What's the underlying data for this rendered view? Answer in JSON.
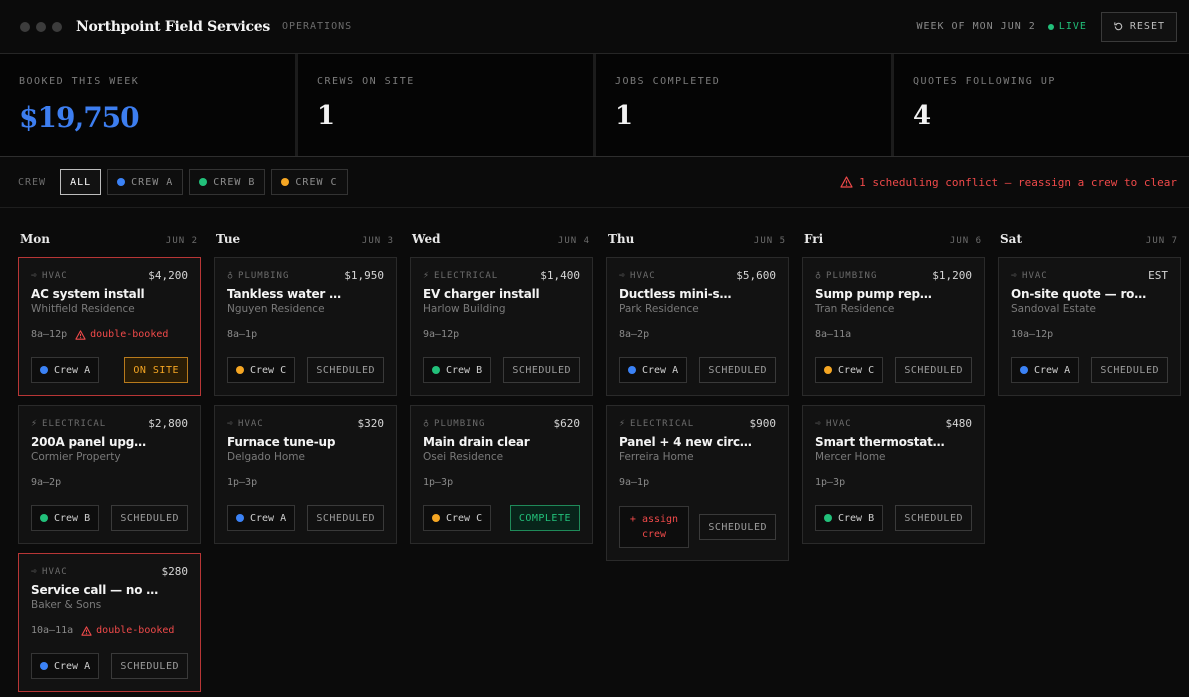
{
  "header": {
    "title": "Northpoint Field Services",
    "subtitle": "OPERATIONS",
    "week": "WEEK OF MON JUN 2",
    "live": "LIVE",
    "reset": "RESET"
  },
  "stats": [
    {
      "label": "BOOKED THIS WEEK",
      "value": "$19,750"
    },
    {
      "label": "CREWS ON SITE",
      "value": "1"
    },
    {
      "label": "JOBS COMPLETED",
      "value": "1"
    },
    {
      "label": "QUOTES FOLLOWING UP",
      "value": "4"
    }
  ],
  "filter": {
    "label": "CREW",
    "chips": [
      "ALL",
      "CREW A",
      "CREW B",
      "CREW C"
    ],
    "conflict": "1 scheduling conflict — reassign a crew to clear"
  },
  "colors": {
    "crew_a": "#3b82f6",
    "crew_b": "#22c07a",
    "crew_c": "#f5a623",
    "conflict": "#f04a4a",
    "accent_blue": "#3d7ef0"
  },
  "days": [
    {
      "day": "Mon",
      "date": "JUN 2",
      "jobs": [
        {
          "trade": "HVAC",
          "price": "$4,200",
          "title": "AC system install",
          "customer": "Whitfield Residence",
          "time": "8a–12p",
          "warning": "double-booked",
          "crew": "Crew A",
          "status": "ON SITE"
        },
        {
          "trade": "ELECTRICAL",
          "price": "$2,800",
          "title": "200A panel upg…",
          "customer": "Cormier Property",
          "time": "9a–2p",
          "crew": "Crew B",
          "status": "SCHEDULED"
        },
        {
          "trade": "HVAC",
          "price": "$280",
          "title": "Service call — no …",
          "customer": "Baker & Sons",
          "time": "10a–11a",
          "warning": "double-booked",
          "crew": "Crew A",
          "status": "SCHEDULED"
        }
      ]
    },
    {
      "day": "Tue",
      "date": "JUN 3",
      "jobs": [
        {
          "trade": "PLUMBING",
          "price": "$1,950",
          "title": "Tankless water …",
          "customer": "Nguyen Residence",
          "time": "8a–1p",
          "crew": "Crew C",
          "status": "SCHEDULED"
        },
        {
          "trade": "HVAC",
          "price": "$320",
          "title": "Furnace tune-up",
          "customer": "Delgado Home",
          "time": "1p–3p",
          "crew": "Crew A",
          "status": "SCHEDULED"
        }
      ]
    },
    {
      "day": "Wed",
      "date": "JUN 4",
      "jobs": [
        {
          "trade": "ELECTRICAL",
          "price": "$1,400",
          "title": "EV charger install",
          "customer": "Harlow Building",
          "time": "9a–12p",
          "crew": "Crew B",
          "status": "SCHEDULED"
        },
        {
          "trade": "PLUMBING",
          "price": "$620",
          "title": "Main drain clear",
          "customer": "Osei Residence",
          "time": "1p–3p",
          "crew": "Crew C",
          "status": "COMPLETE"
        }
      ]
    },
    {
      "day": "Thu",
      "date": "JUN 5",
      "jobs": [
        {
          "trade": "HVAC",
          "price": "$5,600",
          "title": "Ductless mini-s…",
          "customer": "Park Residence",
          "time": "8a–2p",
          "crew": "Crew A",
          "status": "SCHEDULED"
        },
        {
          "trade": "ELECTRICAL",
          "price": "$900",
          "title": "Panel + 4 new circ…",
          "customer": "Ferreira Home",
          "time": "9a–1p",
          "assign": "+ assign crew",
          "status": "SCHEDULED"
        }
      ]
    },
    {
      "day": "Fri",
      "date": "JUN 6",
      "jobs": [
        {
          "trade": "PLUMBING",
          "price": "$1,200",
          "title": "Sump pump rep…",
          "customer": "Tran Residence",
          "time": "8a–11a",
          "crew": "Crew C",
          "status": "SCHEDULED"
        },
        {
          "trade": "HVAC",
          "price": "$480",
          "title": "Smart thermostat…",
          "customer": "Mercer Home",
          "time": "1p–3p",
          "crew": "Crew B",
          "status": "SCHEDULED"
        }
      ]
    },
    {
      "day": "Sat",
      "date": "JUN 7",
      "jobs": [
        {
          "trade": "HVAC",
          "price": "EST",
          "title": "On-site quote — ro…",
          "customer": "Sandoval Estate",
          "time": "10a–12p",
          "crew": "Crew A",
          "status": "SCHEDULED"
        }
      ]
    }
  ]
}
